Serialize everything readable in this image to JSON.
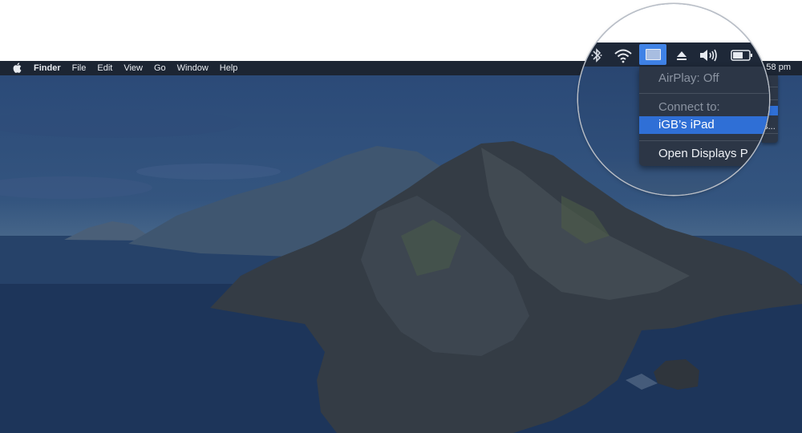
{
  "menubar": {
    "apple_icon": "apple-logo-icon",
    "items": [
      "Finder",
      "File",
      "Edit",
      "View",
      "Go",
      "Window",
      "Help"
    ],
    "clock": "58 pm"
  },
  "status_icons": [
    "bluetooth-icon",
    "wifi-icon",
    "airplay-display-icon",
    "eject-icon",
    "volume-icon",
    "battery-icon"
  ],
  "airplay_menu": {
    "status": "AirPlay: Off",
    "section_header": "Connect to:",
    "device": "iGB’s iPad",
    "open_prefs": "Open Displays P",
    "open_prefs_tail": "es..."
  },
  "colors": {
    "menubar": "#1c2533",
    "menu_bg": "#2c3646",
    "selection": "#2f6fd6",
    "airplay_active": "#3f82e6"
  }
}
